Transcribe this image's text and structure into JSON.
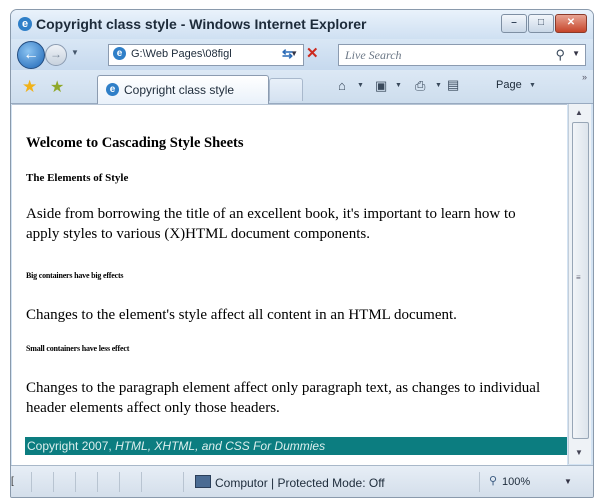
{
  "window": {
    "title": "Copyright class style - Windows Internet Explorer"
  },
  "nav": {
    "address": "G:\\Web Pages\\08figl",
    "search_placeholder": "Live Search"
  },
  "tabs": [
    {
      "label": "Copyright class style"
    }
  ],
  "toolbar": {
    "page_label": "Page"
  },
  "document": {
    "heading1": "Welcome to Cascading Style Sheets",
    "heading2": "The Elements of Style",
    "para1": "Aside from borrowing the title of an excellent book, it's important to learn how to apply styles to various (X)HTML document components.",
    "heading3": "Big containers have big effects",
    "para2": "Changes to the element's style affect all content in an HTML document.",
    "heading4": "Small containers have less effect",
    "para3": "Changes to the paragraph element affect only paragraph text, as changes to individual header elements affect only those headers.",
    "footer_prefix": "Copyright 2007, ",
    "footer_title": "HTML, XHTML, and CSS For Dummies"
  },
  "status": {
    "left_marker": "[",
    "zone": "Computor | Protected Mode: Off",
    "zoom": "100%"
  },
  "colors": {
    "footer_bg": "#0c7d80",
    "footer_text": "#dcefee"
  }
}
